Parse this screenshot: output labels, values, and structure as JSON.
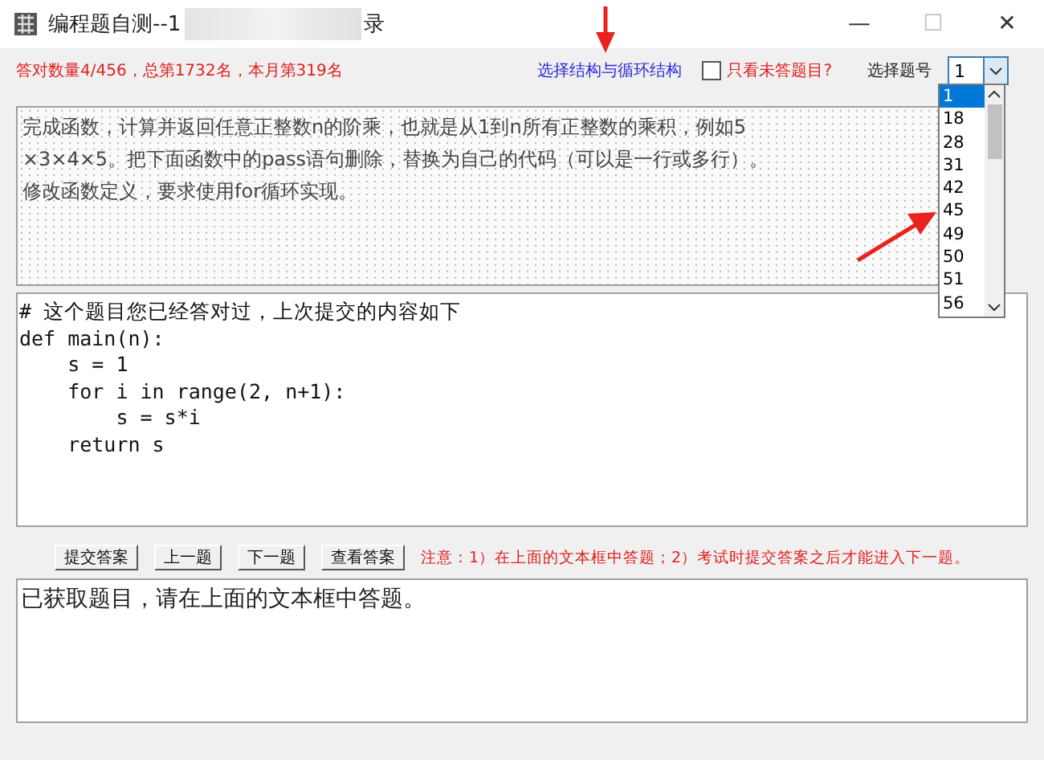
{
  "window": {
    "title": "编程题自测--1",
    "title_end": "录",
    "controls": [
      "—",
      "☐",
      "✕"
    ]
  },
  "toolbar": {
    "score": "答对数量4/456，总第1732名，本月第319名",
    "category": "选择结构与循环结构",
    "unanswered_only": {
      "label": "只看未答题目?",
      "checked": false
    },
    "select_label": "选择题号",
    "select_value": "1"
  },
  "dropdown": {
    "options": [
      {
        "label": "1",
        "selected": true
      },
      {
        "label": "18",
        "selected": false
      },
      {
        "label": "28",
        "selected": false
      },
      {
        "label": "31",
        "selected": false
      },
      {
        "label": "42",
        "selected": false
      },
      {
        "label": "45",
        "selected": false
      },
      {
        "label": "49",
        "selected": false
      },
      {
        "label": "50",
        "selected": false
      },
      {
        "label": "51",
        "selected": false
      },
      {
        "label": "56",
        "selected": false
      }
    ]
  },
  "question": [
    "完成函数，计算并返回任意正整数n的阶乘，也就是从1到n所有正整数的乘积，例如5",
    "×3×4×5。把下面函数中的pass语句删除，替换为自己的代码（可以是一行或多行）。",
    "修改函数定义，要求使用for循环实现。"
  ],
  "code": [
    "# 这个题目您已经答对过，上次提交的内容如下",
    "def main(n):",
    "    s = 1",
    "    for i in range(2, n+1):",
    "        s = s*i",
    "    return s"
  ],
  "buttons": [
    "提交答案",
    "上一题",
    "下一题",
    "查看答案"
  ],
  "note": "注意：1）在上面的文本框中答题；2）考试时提交答案之后才能进入下一题。",
  "status": "已获取题目，请在上面的文本框中答题。"
}
